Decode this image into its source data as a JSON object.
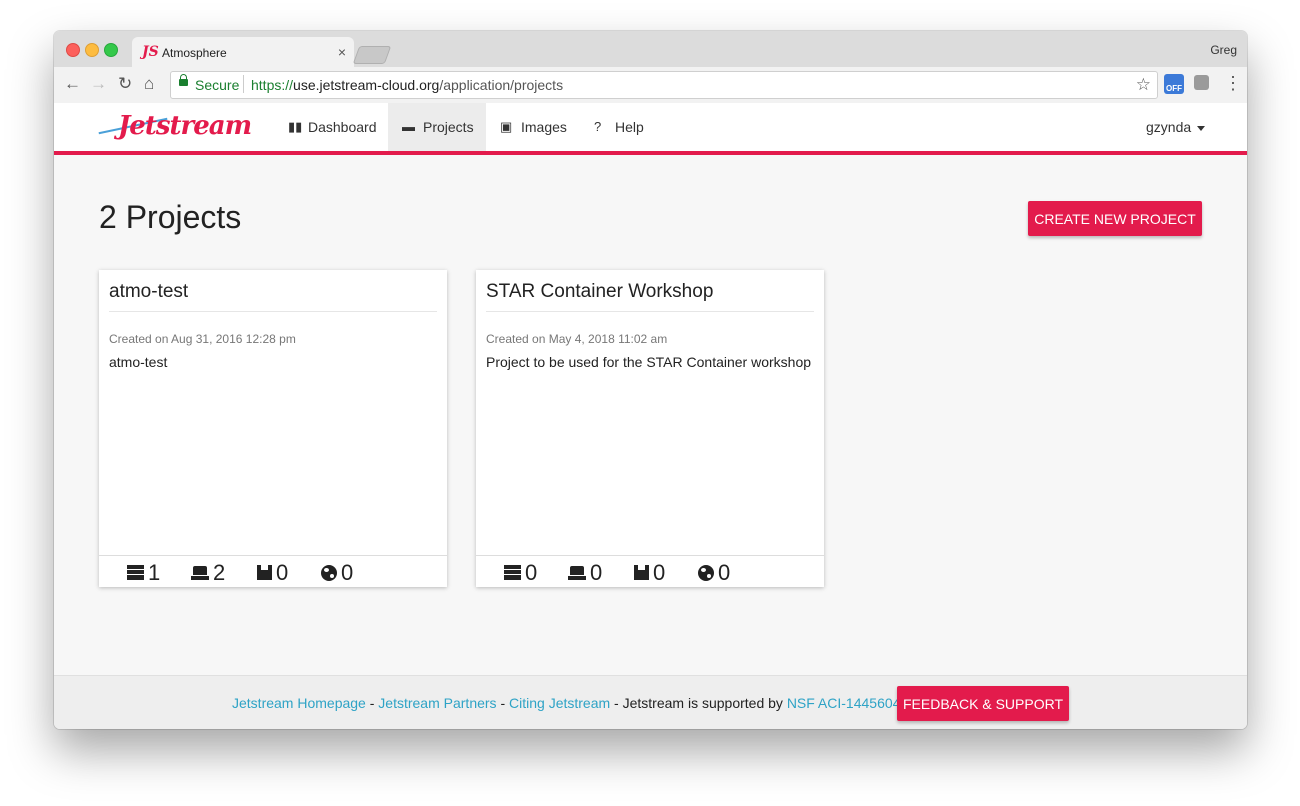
{
  "browser": {
    "tab_title": "Atmosphere",
    "tab_favicon": "JS",
    "profile_name": "Greg",
    "secure_label": "Secure",
    "url_scheme": "https://",
    "url_host": "use.jetstream-cloud.org",
    "url_path": "/application/projects",
    "extension_badge": "OFF"
  },
  "header": {
    "logo_text": "Jetstream",
    "nav": [
      {
        "label": "Dashboard",
        "icon": "bar-chart-icon"
      },
      {
        "label": "Projects",
        "icon": "folder-open-icon",
        "active": true
      },
      {
        "label": "Images",
        "icon": "floppy-disk-icon"
      },
      {
        "label": "Help",
        "icon": "question-circle-icon"
      }
    ],
    "user": "gzynda"
  },
  "main": {
    "title": "2 Projects",
    "create_button": "CREATE NEW PROJECT",
    "projects": [
      {
        "name": "atmo-test",
        "created": "Created on Aug 31, 2016 12:28 pm",
        "description": "atmo-test",
        "stats": {
          "instances": "1",
          "volumes": "2",
          "images": "0",
          "links": "0"
        }
      },
      {
        "name": "STAR Container Workshop",
        "created": "Created on May 4, 2018 11:02 am",
        "description": "Project to be used for the STAR Container workshop",
        "stats": {
          "instances": "0",
          "volumes": "0",
          "images": "0",
          "links": "0"
        }
      }
    ]
  },
  "footer": {
    "homepage": "Jetstream Homepage",
    "sep1": " - ",
    "partners": "Jetstream Partners",
    "sep2": " - ",
    "citing": "Citing Jetstream",
    "supported_text": " - Jetstream is supported by ",
    "nsf": "NSF ACI-1445604",
    "feedback_button": "FEEDBACK & SUPPORT"
  },
  "colors": {
    "accent": "#e31b4c",
    "link": "#2ea3c6",
    "secure": "#1a7f2f"
  }
}
